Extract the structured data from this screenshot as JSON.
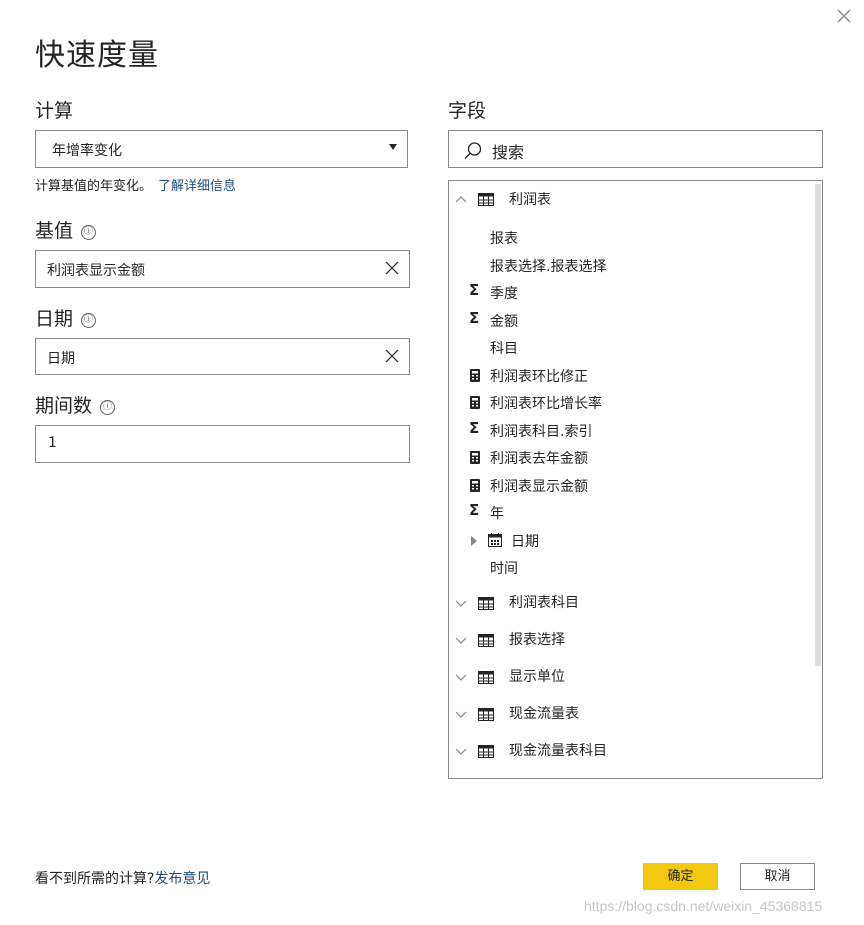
{
  "dialog": {
    "title": "快速度量"
  },
  "calculation": {
    "label": "计算",
    "selected": "年增率变化",
    "helper_text": "计算基值的年变化。",
    "learn_more_link": "了解详细信息"
  },
  "base_value": {
    "label": "基值",
    "info_icon": "ⓘ",
    "value": "利润表显示金额"
  },
  "date": {
    "label": "日期",
    "info_icon": "ⓘ",
    "value": "日期"
  },
  "periods": {
    "label": "期间数",
    "info_icon": "ⓘ",
    "value": "1"
  },
  "fields": {
    "label": "字段",
    "search_placeholder": "搜索",
    "tables": [
      {
        "name": "利润表",
        "expanded": true,
        "items": [
          {
            "name": "报表",
            "icon": "none"
          },
          {
            "name": "报表选择.报表选择",
            "icon": "none"
          },
          {
            "name": "季度",
            "icon": "sigma"
          },
          {
            "name": "金额",
            "icon": "sigma"
          },
          {
            "name": "科目",
            "icon": "none"
          },
          {
            "name": "利润表环比修正",
            "icon": "calculator"
          },
          {
            "name": "利润表环比增长率",
            "icon": "calculator"
          },
          {
            "name": "利润表科目.索引",
            "icon": "sigma"
          },
          {
            "name": "利润表去年金额",
            "icon": "calculator"
          },
          {
            "name": "利润表显示金额",
            "icon": "calculator"
          },
          {
            "name": "年",
            "icon": "sigma"
          },
          {
            "name": "日期",
            "icon": "calendar"
          },
          {
            "name": "时间",
            "icon": "none"
          }
        ]
      },
      {
        "name": "利润表科目",
        "expanded": false
      },
      {
        "name": "报表选择",
        "expanded": false
      },
      {
        "name": "显示单位",
        "expanded": false
      },
      {
        "name": "现金流量表",
        "expanded": false
      },
      {
        "name": "现金流量表科目",
        "expanded": false
      }
    ]
  },
  "footer": {
    "question": "看不到所需的计算?",
    "feedback_link": "发布意见",
    "ok_label": "确定",
    "cancel_label": "取消"
  },
  "watermark": "https://blog.csdn.net/weixin_45368815",
  "colors": {
    "primary_button": "#f2c811",
    "link": "#1f4e79",
    "border": "#8a8886"
  }
}
